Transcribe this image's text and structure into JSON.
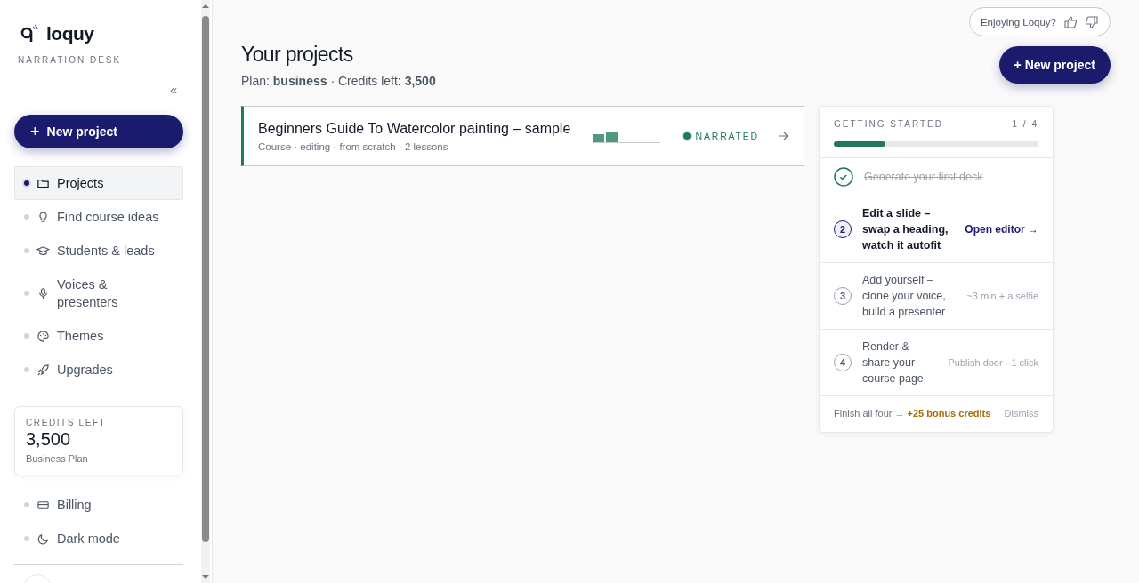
{
  "sidebar": {
    "brand": "loquy",
    "tagline": "NARRATION DESK",
    "collapse": "«",
    "new_project_plus": "+",
    "new_project": "New project",
    "nav": [
      {
        "label": "Projects",
        "selected": true
      },
      {
        "label": "Find course ideas",
        "selected": false
      },
      {
        "label": "Students & leads",
        "selected": false
      },
      {
        "label": "Voices & presenters",
        "selected": false
      },
      {
        "label": "Themes",
        "selected": false
      },
      {
        "label": "Upgrades",
        "selected": false
      }
    ],
    "credits": {
      "label": "CREDITS LEFT",
      "value": "3,500",
      "plan": "Business Plan"
    },
    "bottom_nav": [
      {
        "label": "Billing",
        "selected": false
      },
      {
        "label": "Dark mode",
        "selected": false
      }
    ]
  },
  "feedback": {
    "label": "Enjoying Loquy?"
  },
  "header": {
    "title": "Your projects",
    "subtitle": "Plan: **business** · Credits left: **3,500**",
    "new_project": "+ New project"
  },
  "projects": [
    {
      "title": "Beginners Guide To Watercolor painting – sample",
      "meta": "Course · editing · from scratch · 2 lessons",
      "status": "NARRATED",
      "color": "#1f7a55"
    }
  ],
  "getting_started": {
    "title": "GETTING STARTED",
    "count": "1 / 4",
    "level": 0.25,
    "steps": [
      {
        "kind": "done",
        "text": "Generate your first deck"
      },
      {
        "kind": "current",
        "number": "2",
        "text": "Edit a slide – swap a heading, watch it autofit",
        "action": "Open editor →"
      },
      {
        "kind": "pending",
        "number": "3",
        "text": "Add yourself – clone your voice, build a presenter",
        "hint": "~3 min + a selfie"
      },
      {
        "kind": "pending",
        "number": "4",
        "text": "Render & share your course page",
        "hint": "Publish door · 1 click"
      }
    ],
    "footer": "Finish all four → **+25 bonus credits**",
    "dismiss": "Dismiss"
  }
}
